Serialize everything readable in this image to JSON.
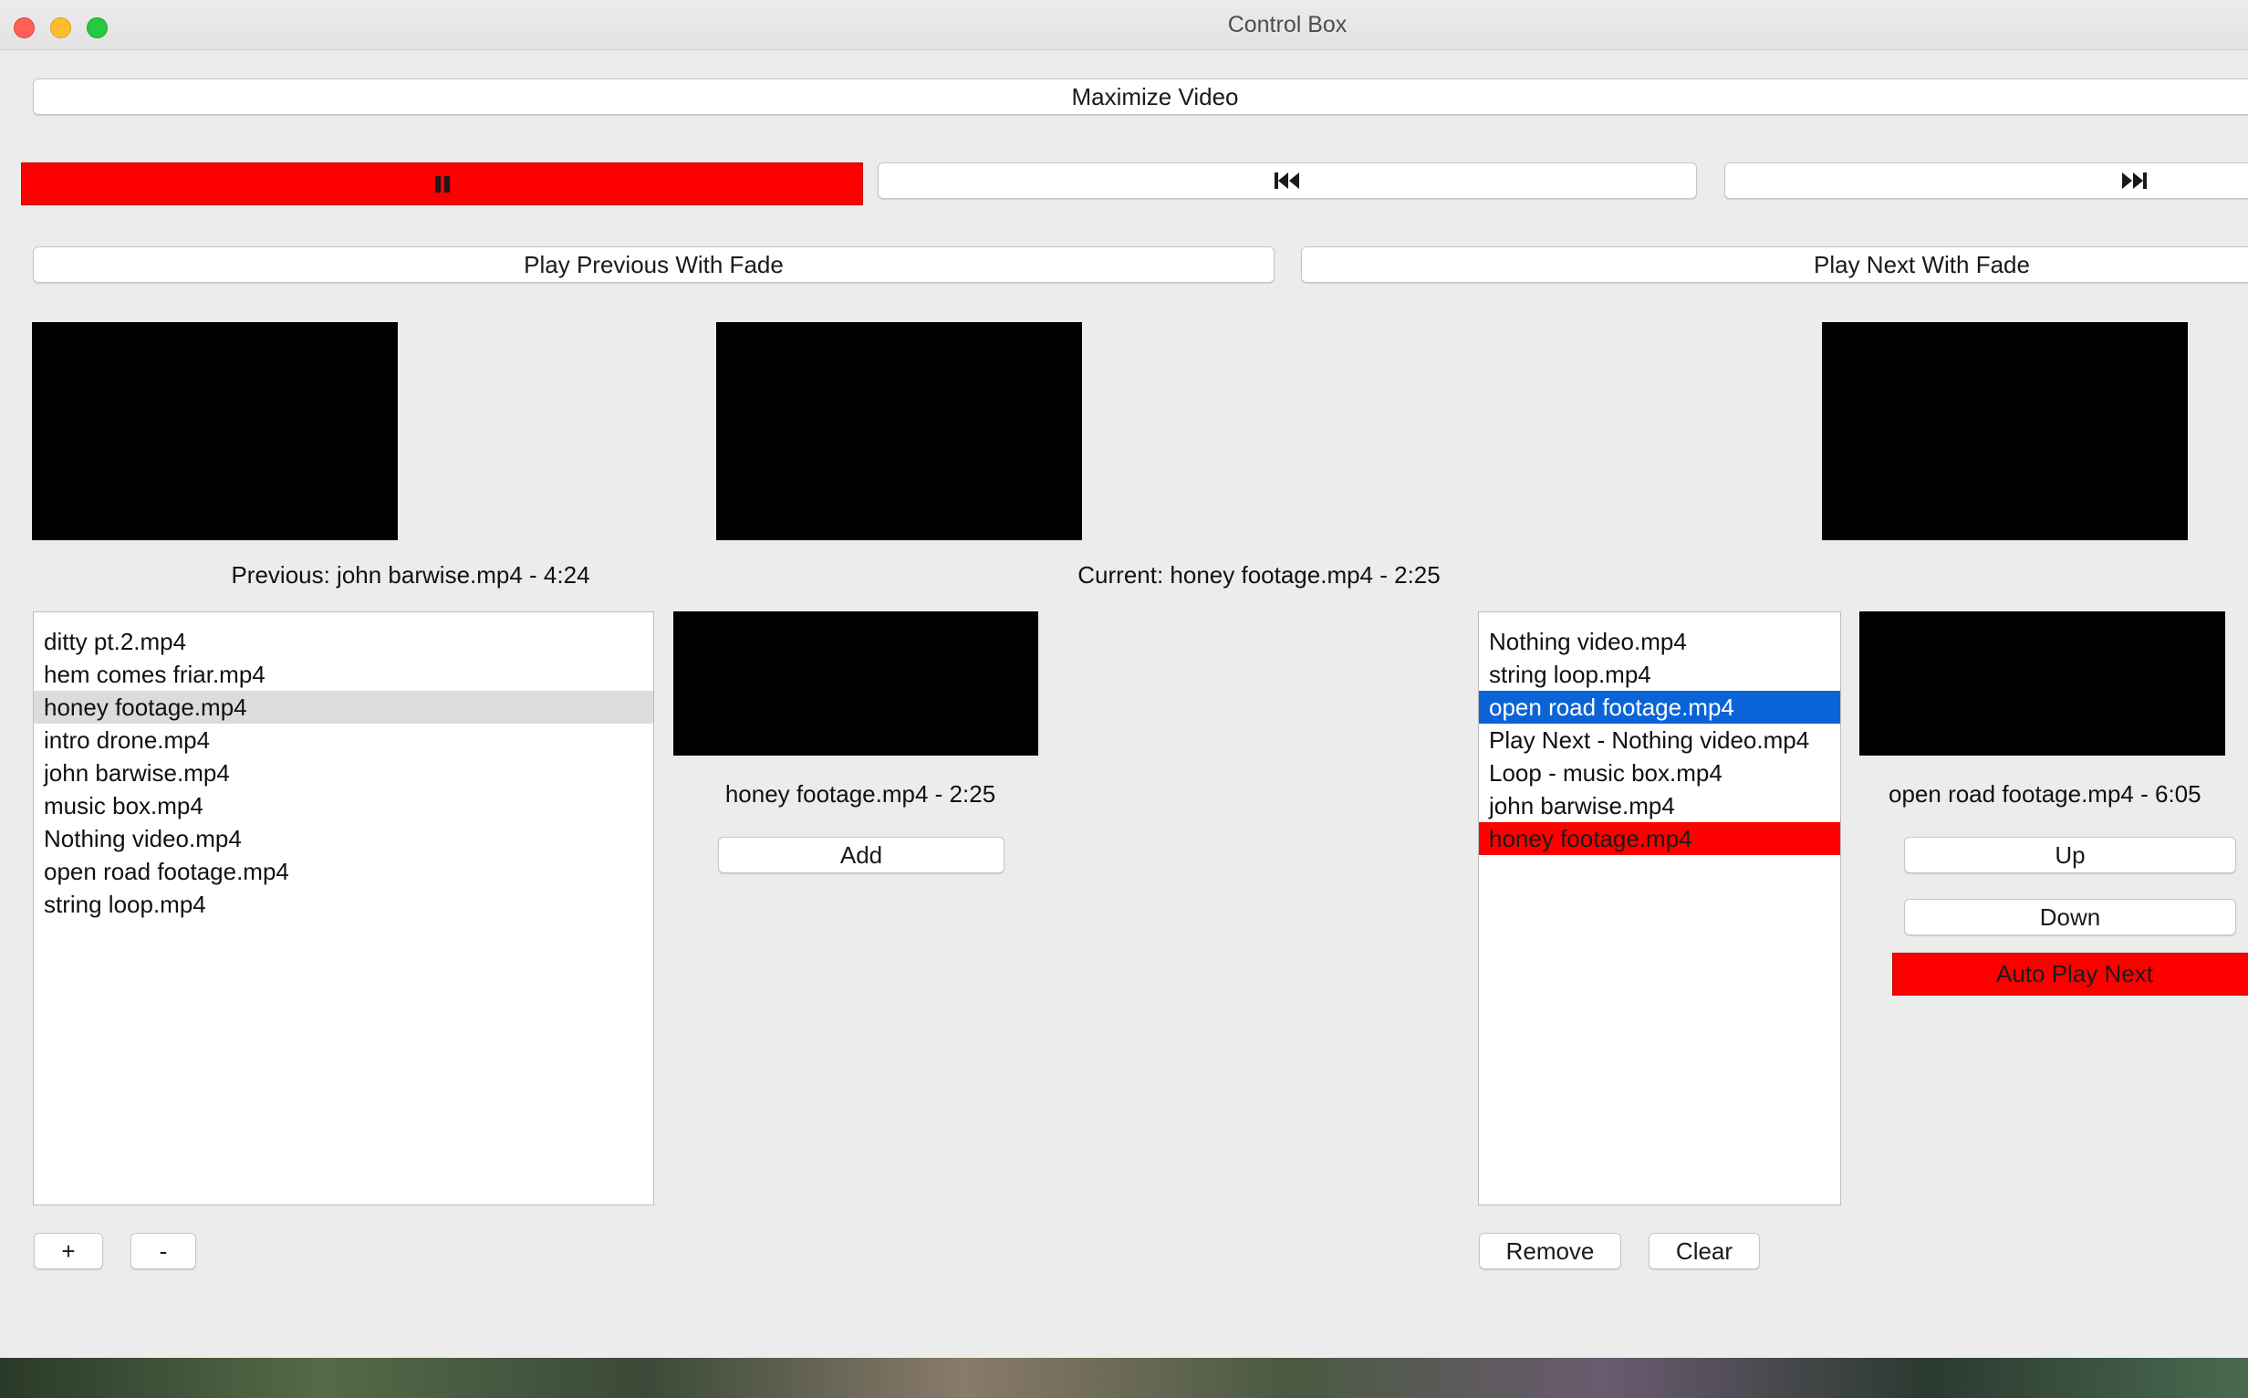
{
  "window": {
    "title": "Control Box"
  },
  "toolbar": {
    "maximize_label": "Maximize Video",
    "pause_icon": "pause-icon",
    "previous_icon": "skip-previous-icon",
    "next_icon": "skip-next-icon",
    "play_previous_fade_label": "Play Previous With Fade",
    "play_next_fade_label": "Play Next With Fade"
  },
  "previews": {
    "previous_text": "Previous: john barwise.mp4 - 4:24",
    "current_text": "Current: honey footage.mp4 - 2:25"
  },
  "library": {
    "items": [
      "ditty pt.2.mp4",
      "hem comes friar.mp4",
      "honey footage.mp4",
      "intro drone.mp4",
      "john barwise.mp4",
      "music box.mp4",
      "Nothing video.mp4",
      "open road footage.mp4",
      "string loop.mp4"
    ],
    "selected_index": 2,
    "add_file_label": "+",
    "remove_file_label": "-"
  },
  "library_preview": {
    "caption": "honey footage.mp4 - 2:25",
    "add_label": "Add"
  },
  "queue": {
    "items": [
      "Nothing video.mp4",
      "string loop.mp4",
      "open road footage.mp4",
      "Play Next - Nothing video.mp4",
      "Loop - music box.mp4",
      "john barwise.mp4",
      "honey footage.mp4"
    ],
    "selected_index": 2,
    "playing_index": 6,
    "remove_label": "Remove",
    "clear_label": "Clear"
  },
  "queue_preview": {
    "caption": "open road footage.mp4 - 6:05",
    "up_label": "Up",
    "down_label": "Down",
    "auto_play_label": "Auto Play Next"
  },
  "colors": {
    "active_red": "#ff0000",
    "selection_blue": "#0a64d8",
    "selection_gray": "#dcdcdc",
    "window_bg": "#ececec"
  }
}
